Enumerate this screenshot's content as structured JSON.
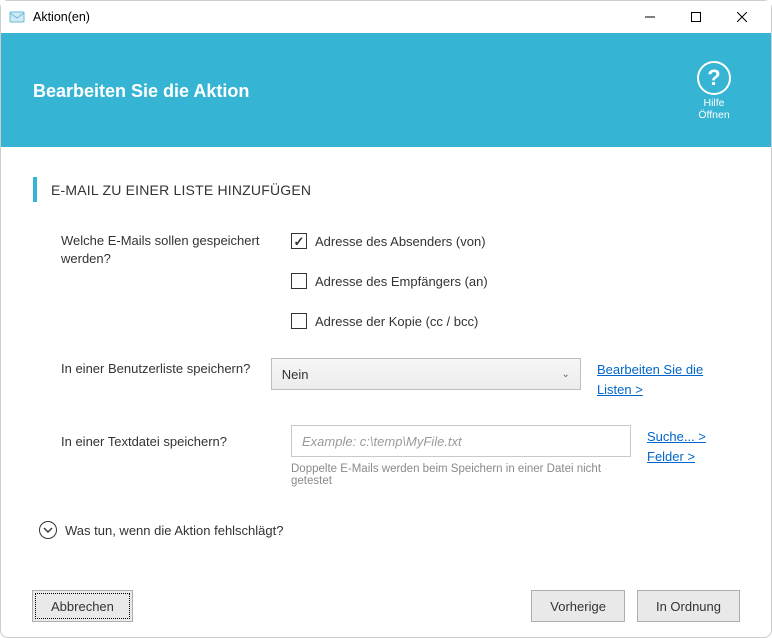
{
  "window": {
    "title": "Aktion(en)"
  },
  "header": {
    "title": "Bearbeiten Sie die Aktion",
    "help_line1": "Hilfe",
    "help_line2": "Öffnen"
  },
  "section": {
    "title": "E-MAIL ZU EINER LISTE HINZUFÜGEN"
  },
  "form": {
    "emails_label": "Welche E-Mails sollen gespeichert werden?",
    "opt_sender": {
      "label": "Adresse des Absenders (von)",
      "checked": true
    },
    "opt_recipient": {
      "label": "Adresse des Empfängers (an)",
      "checked": false
    },
    "opt_copy": {
      "label": "Adresse der Kopie (cc / bcc)",
      "checked": false
    },
    "userlist_label": "In einer Benutzerliste speichern?",
    "userlist_value": "Nein",
    "userlist_link": "Bearbeiten Sie die Listen >",
    "textfile_label": "In einer Textdatei speichern?",
    "textfile_placeholder": "Example: c:\\temp\\MyFile.txt",
    "textfile_hint": "Doppelte E-Mails werden beim Speichern in einer Datei nicht getestet",
    "search_link": "Suche... >",
    "fields_link": "Felder >"
  },
  "expander": {
    "label": "Was tun, wenn die Aktion fehlschlägt?"
  },
  "footer": {
    "cancel": "Abbrechen",
    "prev": "Vorherige",
    "ok": "In Ordnung"
  }
}
